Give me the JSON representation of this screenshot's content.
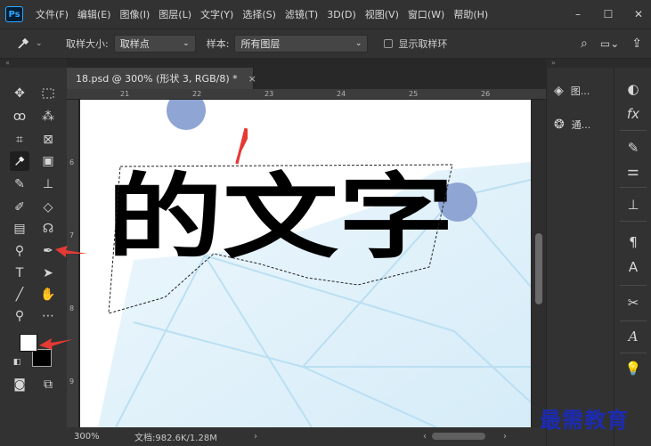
{
  "app": {
    "logo": "Ps",
    "menu": [
      "文件(F)",
      "编辑(E)",
      "图像(I)",
      "图层(L)",
      "文字(Y)",
      "选择(S)",
      "滤镜(T)",
      "3D(D)",
      "视图(V)",
      "窗口(W)",
      "帮助(H)"
    ]
  },
  "options": {
    "sample_size_label": "取样大小:",
    "sample_size_value": "取样点",
    "sample_label": "样本:",
    "sample_value": "所有图层",
    "show_ring_label": "显示取样环"
  },
  "document": {
    "tab_title": "18.psd @ 300% (形状 3, RGB/8) *",
    "tab_close": "×",
    "ruler_top": [
      "21",
      "22",
      "23",
      "24",
      "25",
      "26"
    ],
    "ruler_left": [
      "6",
      "7",
      "8",
      "9"
    ],
    "canvas_text": "的文字"
  },
  "status": {
    "zoom": "300%",
    "doc_info": "文档:982.6K/1.28M",
    "arrows_left": "‹",
    "arrows_right": "›"
  },
  "panels": {
    "layers_label": "图...",
    "channels_label": "通..."
  },
  "colors": {
    "accent": "#31a8ff",
    "foreground": "#ffffff",
    "background": "#000000",
    "watermark": "#1c2bb3",
    "arrow": "#e53935"
  },
  "watermark": "最需教育"
}
